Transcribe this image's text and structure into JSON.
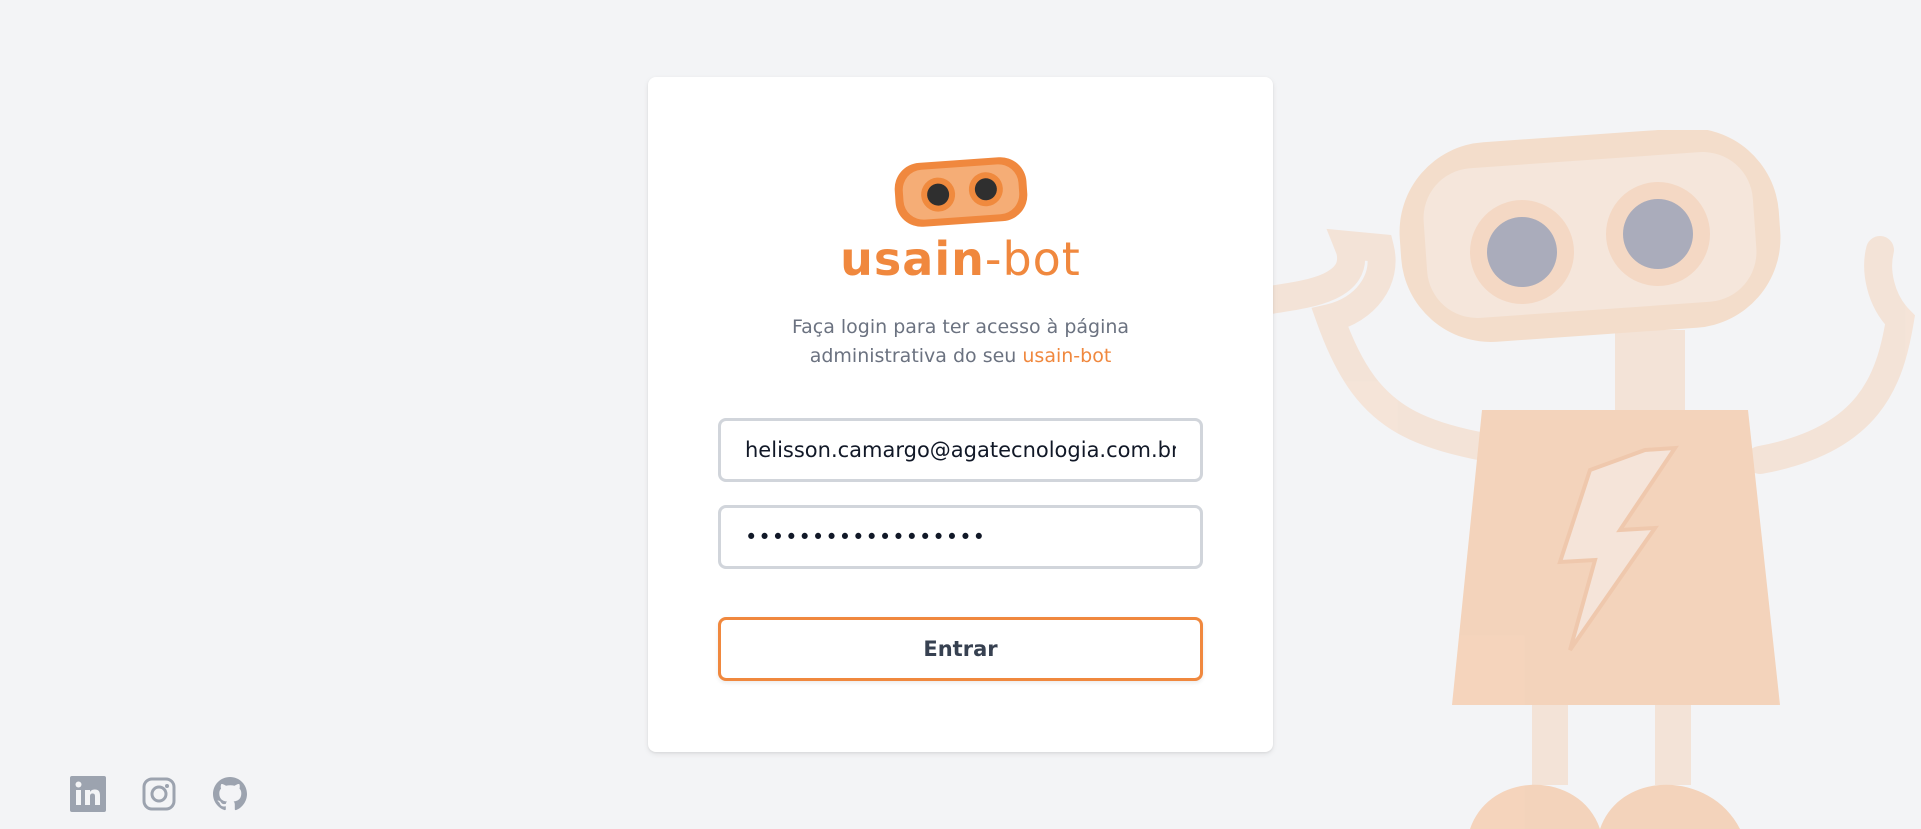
{
  "brand": {
    "name_part1": "usain",
    "name_dash": "-",
    "name_part2": "bot"
  },
  "login": {
    "subtitle_line1": "Faça login para ter acesso à página",
    "subtitle_line2": "administrativa do seu",
    "subtitle_highlight": "usain-bot",
    "email_value": "helisson.camargo@agatecnologia.com.br",
    "password_value": "••••••••••••••••••",
    "submit_label": "Entrar"
  },
  "footer": {
    "icons": [
      "linkedin-icon",
      "instagram-icon",
      "github-icon"
    ]
  },
  "colors": {
    "accent": "#f0883e",
    "background": "#f3f4f6",
    "card": "#ffffff",
    "text_muted": "#6b7280",
    "icon_gray": "#9ca3af"
  }
}
